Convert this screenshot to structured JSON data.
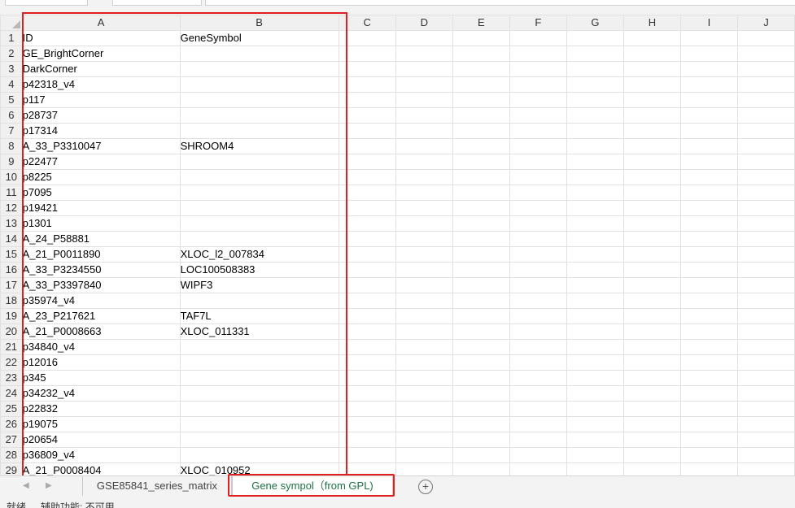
{
  "columns": [
    "A",
    "B",
    "C",
    "D",
    "E",
    "F",
    "G",
    "H",
    "I",
    "J"
  ],
  "rows": [
    {
      "num": "1",
      "a": "ID",
      "b": "GeneSymbol"
    },
    {
      "num": "2",
      "a": "GE_BrightCorner",
      "b": ""
    },
    {
      "num": "3",
      "a": "DarkCorner",
      "b": ""
    },
    {
      "num": "4",
      "a": "p42318_v4",
      "b": ""
    },
    {
      "num": "5",
      "a": "p117",
      "b": ""
    },
    {
      "num": "6",
      "a": "p28737",
      "b": ""
    },
    {
      "num": "7",
      "a": "p17314",
      "b": ""
    },
    {
      "num": "8",
      "a": "A_33_P3310047",
      "b": "SHROOM4"
    },
    {
      "num": "9",
      "a": "p22477",
      "b": ""
    },
    {
      "num": "10",
      "a": "p8225",
      "b": ""
    },
    {
      "num": "11",
      "a": "p7095",
      "b": ""
    },
    {
      "num": "12",
      "a": "p19421",
      "b": ""
    },
    {
      "num": "13",
      "a": "p1301",
      "b": ""
    },
    {
      "num": "14",
      "a": "A_24_P58881",
      "b": ""
    },
    {
      "num": "15",
      "a": "A_21_P0011890",
      "b": "XLOC_l2_007834"
    },
    {
      "num": "16",
      "a": "A_33_P3234550",
      "b": "LOC100508383"
    },
    {
      "num": "17",
      "a": "A_33_P3397840",
      "b": "WIPF3"
    },
    {
      "num": "18",
      "a": "p35974_v4",
      "b": ""
    },
    {
      "num": "19",
      "a": "A_23_P217621",
      "b": "TAF7L"
    },
    {
      "num": "20",
      "a": "A_21_P0008663",
      "b": "XLOC_011331"
    },
    {
      "num": "21",
      "a": "p34840_v4",
      "b": ""
    },
    {
      "num": "22",
      "a": "p12016",
      "b": ""
    },
    {
      "num": "23",
      "a": "p345",
      "b": ""
    },
    {
      "num": "24",
      "a": "p34232_v4",
      "b": ""
    },
    {
      "num": "25",
      "a": "p22832",
      "b": ""
    },
    {
      "num": "26",
      "a": "p19075",
      "b": ""
    },
    {
      "num": "27",
      "a": "p20654",
      "b": ""
    },
    {
      "num": "28",
      "a": "p36809_v4",
      "b": ""
    },
    {
      "num": "29",
      "a": "A_21_P0008404",
      "b": "XLOC_010952"
    }
  ],
  "tabs": {
    "sheet1": "GSE85841_series_matrix",
    "sheet2": "Gene sympol（from GPL)",
    "add": "+"
  },
  "nav": {
    "prev": "◀",
    "next": "▶"
  },
  "status": {
    "ready": "就绪",
    "accessibility": "辅助功能: 不可用"
  },
  "colors": {
    "accent": "#1e7145",
    "highlight": "#e02020"
  }
}
